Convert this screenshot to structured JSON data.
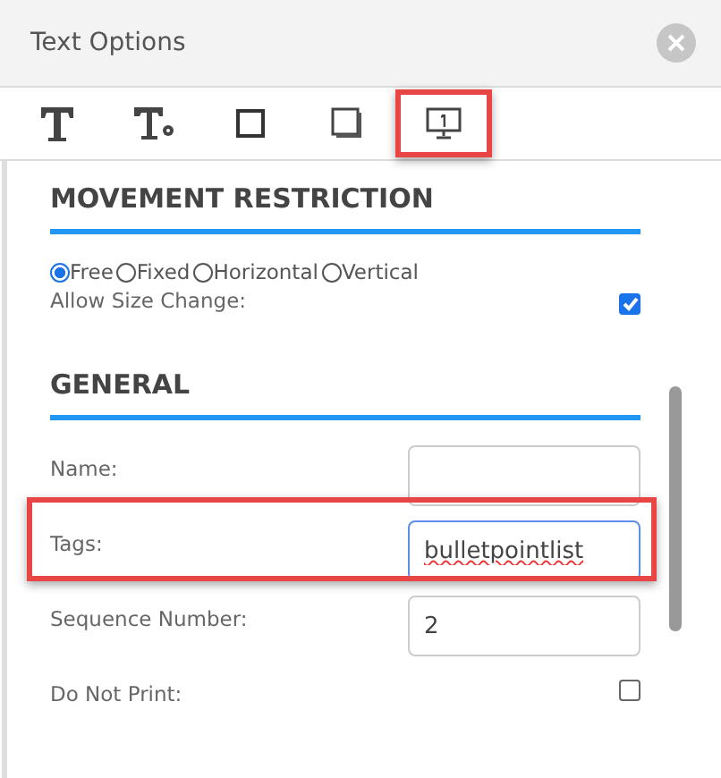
{
  "window": {
    "title": "Text Options"
  },
  "tabs": [
    {
      "kind": "text",
      "selected": false
    },
    {
      "kind": "textsettings",
      "selected": false
    },
    {
      "kind": "border",
      "selected": false
    },
    {
      "kind": "shadow",
      "selected": false
    },
    {
      "kind": "screen",
      "selected": true
    }
  ],
  "movement": {
    "heading": "MOVEMENT RESTRICTION",
    "options": [
      {
        "label": "Free",
        "selected": true
      },
      {
        "label": "Fixed",
        "selected": false
      },
      {
        "label": "Horizontal",
        "selected": false
      },
      {
        "label": "Vertical",
        "selected": false
      }
    ],
    "allow_size_change": {
      "label": "Allow Size Change:",
      "checked": true
    }
  },
  "general": {
    "heading": "GENERAL",
    "rows": [
      {
        "kind": "input",
        "label": "Name:",
        "highlighted": false
      },
      {
        "kind": "input",
        "label": "Tags:",
        "value": "bulletpointlist",
        "focused": true,
        "highlighted": true
      },
      {
        "kind": "input",
        "label": "Sequence Number:",
        "value": "2",
        "highlighted": false
      },
      {
        "kind": "checkbox",
        "label": "Do Not Print:",
        "checked": false
      }
    ]
  }
}
